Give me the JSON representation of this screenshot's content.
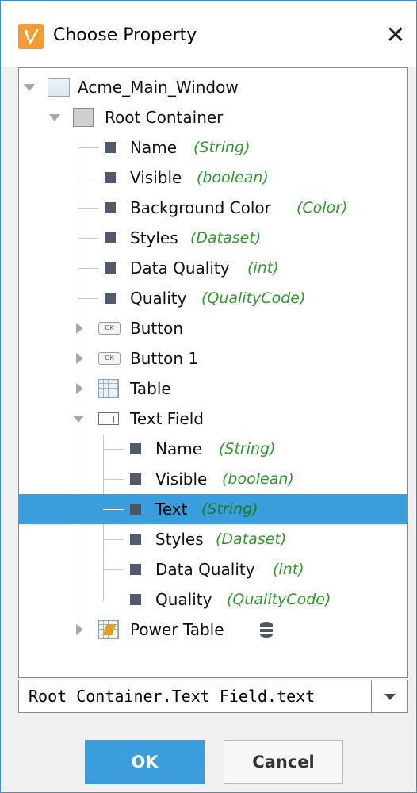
{
  "dialog": {
    "title": "Choose Property",
    "close_glyph": "✕",
    "app_icon": "property-picker-icon",
    "accent_color": "#3a9ddc"
  },
  "tree": {
    "root": {
      "label": "Acme_Main_Window",
      "icon": "window-icon"
    },
    "root_container": {
      "label": "Root Container",
      "icon": "container-icon",
      "properties": [
        {
          "name": "Name",
          "type": "(String)"
        },
        {
          "name": "Visible",
          "type": "(boolean)"
        },
        {
          "name": "Background Color",
          "type": "(Color)"
        },
        {
          "name": "Styles",
          "type": "(Dataset)"
        },
        {
          "name": "Data Quality",
          "type": "(int)"
        },
        {
          "name": "Quality",
          "type": "(QualityCode)"
        }
      ],
      "children": [
        {
          "label": "Button",
          "icon": "button-icon",
          "icon_text": "OK"
        },
        {
          "label": "Button 1",
          "icon": "button-icon",
          "icon_text": "OK"
        },
        {
          "label": "Table",
          "icon": "table-icon"
        },
        {
          "label": "Text Field",
          "icon": "text-field-icon",
          "properties": [
            {
              "name": "Name",
              "type": "(String)"
            },
            {
              "name": "Visible",
              "type": "(boolean)"
            },
            {
              "name": "Text",
              "type": "(String)",
              "selected": true
            },
            {
              "name": "Styles",
              "type": "(Dataset)"
            },
            {
              "name": "Data Quality",
              "type": "(int)"
            },
            {
              "name": "Quality",
              "type": "(QualityCode)"
            }
          ]
        },
        {
          "label": "Power Table",
          "icon": "power-table-icon",
          "badge_icon": "database-icon"
        }
      ]
    }
  },
  "path_field": {
    "value": "Root Container.Text Field.text"
  },
  "buttons": {
    "ok": "OK",
    "cancel": "Cancel"
  }
}
